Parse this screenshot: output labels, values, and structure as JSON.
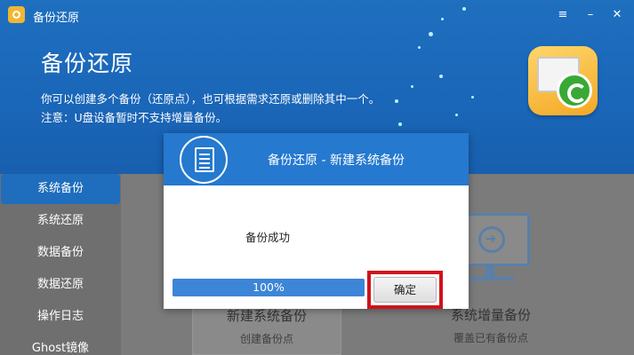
{
  "window": {
    "app_title": "备份还原",
    "controls": [
      "≡",
      "–",
      "✕"
    ]
  },
  "banner": {
    "title": "备份还原",
    "desc_line1": "你可以创建多个备份（还原点），也可根据需求还原或删除其中一个。",
    "desc_line2": "注意：U盘设备暂时不支持增量备份。",
    "icon": "backup-restore-icon"
  },
  "sidebar": {
    "items": [
      {
        "label": "系统备份",
        "active": true
      },
      {
        "label": "系统还原",
        "active": false
      },
      {
        "label": "数据备份",
        "active": false
      },
      {
        "label": "数据还原",
        "active": false
      },
      {
        "label": "操作日志",
        "active": false
      },
      {
        "label": "Ghost镜像",
        "active": false
      }
    ]
  },
  "main": {
    "cards": [
      {
        "title": "新建系统备份",
        "subtitle": "创建备份点"
      },
      {
        "title": "系统增量备份",
        "subtitle": "覆盖已有备份点"
      }
    ]
  },
  "dialog": {
    "title": "备份还原 - 新建系统备份",
    "message": "备份成功",
    "progress_value": 100,
    "progress_text": "100%",
    "ok_label": "确定",
    "highlight_color": "#d0121c"
  },
  "colors": {
    "accent": "#2579cf",
    "header_bg": "#1f6fbf",
    "sidebar_active": "#1f6dbd"
  }
}
